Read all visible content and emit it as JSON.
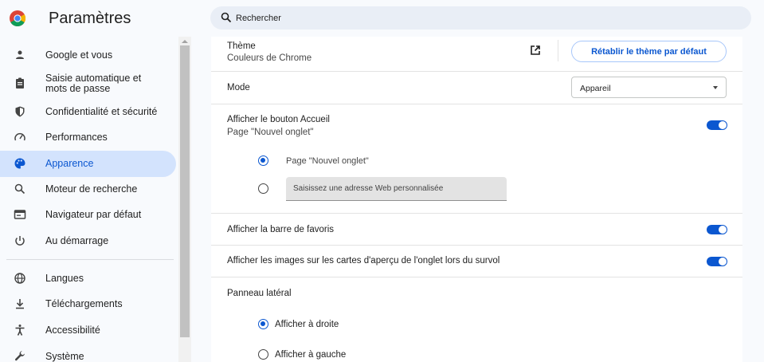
{
  "header": {
    "app_icon": "chrome-logo-icon",
    "title": "Paramètres",
    "search_icon": "search-icon",
    "search_placeholder": "Rechercher"
  },
  "sidebar": {
    "items": [
      {
        "label": "Google et vous",
        "icon": "person-icon"
      },
      {
        "label": "Saisie automatique et\nmots de passe",
        "icon": "clipboard-icon"
      },
      {
        "label": "Confidentialité et sécurité",
        "icon": "shield-icon"
      },
      {
        "label": "Performances",
        "icon": "speedometer-icon"
      },
      {
        "label": "Apparence",
        "icon": "palette-icon",
        "active": true
      },
      {
        "label": "Moteur de recherche",
        "icon": "search-icon"
      },
      {
        "label": "Navigateur par défaut",
        "icon": "browser-icon"
      },
      {
        "label": "Au démarrage",
        "icon": "power-icon"
      },
      {
        "label": "Langues",
        "icon": "globe-icon"
      },
      {
        "label": "Téléchargements",
        "icon": "download-icon"
      },
      {
        "label": "Accessibilité",
        "icon": "accessibility-icon"
      },
      {
        "label": "Système",
        "icon": "wrench-icon"
      }
    ]
  },
  "appearance": {
    "theme": {
      "label": "Thème",
      "value": "Couleurs de Chrome",
      "open_icon": "open-in-new-icon",
      "reset_label": "Rétablir le thème par défaut"
    },
    "mode": {
      "label": "Mode",
      "value": "Appareil"
    },
    "home_button": {
      "label": "Afficher le bouton Accueil",
      "sublabel": "Page \"Nouvel onglet\"",
      "enabled": true,
      "options": [
        {
          "label": "Page \"Nouvel onglet\"",
          "checked": true
        },
        {
          "placeholder": "Saisissez une adresse Web personnalisée",
          "checked": false
        }
      ]
    },
    "bookmarks_bar": {
      "label": "Afficher la barre de favoris",
      "enabled": true
    },
    "tab_hover_images": {
      "label": "Afficher les images sur les cartes d'aperçu de l'onglet lors du survol",
      "enabled": true
    },
    "side_panel": {
      "label": "Panneau latéral",
      "options": [
        {
          "label": "Afficher à droite",
          "checked": true
        },
        {
          "label": "Afficher à gauche",
          "checked": false
        }
      ]
    }
  },
  "colors": {
    "accent": "#0b57d0",
    "active_nav_bg": "#d3e3fd",
    "search_bg": "#e9eef6",
    "page_bg": "#f8fafd"
  }
}
